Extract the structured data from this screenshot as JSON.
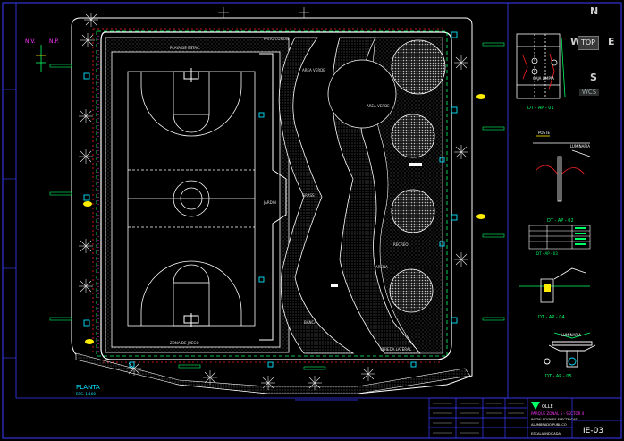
{
  "plan": {
    "label": "PLANTA",
    "scale": "ESC. 1:100",
    "path_label": "PATIO COMUN",
    "court_label": "PLAYA DE ESTAC.",
    "grass_label": "AREA VERDE",
    "jardin_label": "JARDIN",
    "banca_label": "BANCA",
    "area_label": "AREA VERDE",
    "recreo_label": "RECREO",
    "soil_label": "ARENA",
    "lawn_label": "GRASS",
    "nv": "N.V.",
    "np": "N.P.",
    "dimension_bottom": "VEREDA LATERAL",
    "bottom_label": "ZONA DE JUEGO",
    "vereda_label": "VEREDA",
    "stair_label": "JARDINERA",
    "access_label": "ACCESO"
  },
  "details": {
    "top_tag": "DT - AP - 01",
    "top_detail": "CAJA LIMPIA",
    "mid_tag": "DT - AP - 02",
    "mid_label": "POSTE",
    "mid_sub": "LUMINARIA",
    "table_tag": "DT - AP - 03",
    "small_tag": "DT - AP - 04",
    "bottom_tag": "DT - AP - 05",
    "lamp_label": "LUMINARIA"
  },
  "title_block": {
    "company": "OLLE",
    "project": "PARQUE ZONAL 5 - SECTOR 4",
    "sheet": "IE-03",
    "sheet_title": "INSTALACIONES ELECTRICAS",
    "sub_title": "ALUMBRADO PUBLICO",
    "scale_note": "ESCALA INDICADA"
  },
  "viewcube": {
    "n": "N",
    "s": "S",
    "w": "W",
    "e": "E",
    "top": "TOP",
    "wcs": "WCS"
  },
  "colors": {
    "frame": "#3b3bff",
    "wall": "#ffffff",
    "line_green": "#00ff66",
    "line_cyan": "#00e5ff",
    "line_yellow": "#ffee00",
    "line_red": "#ff2222",
    "line_magenta": "#ff33ff",
    "hatch": "#9a9a9a"
  }
}
